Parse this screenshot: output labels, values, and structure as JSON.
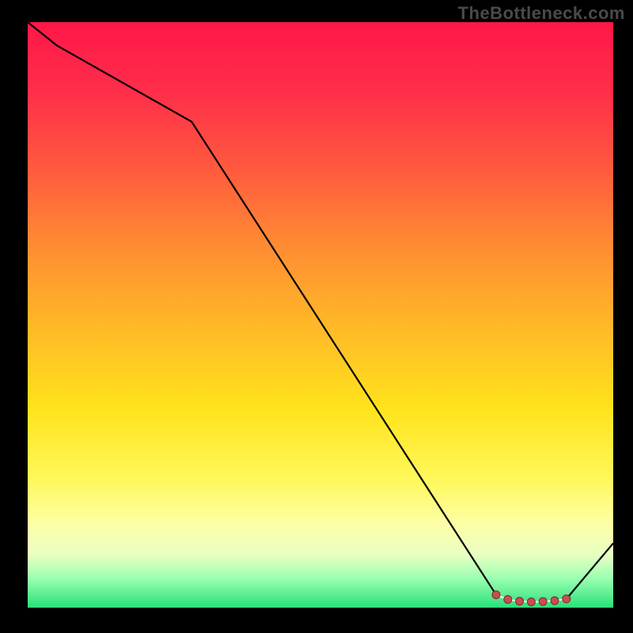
{
  "watermark": "TheBottleneck.com",
  "chart_data": {
    "type": "line",
    "title": "",
    "xlabel": "",
    "ylabel": "",
    "xlim": [
      0,
      100
    ],
    "ylim": [
      0,
      100
    ],
    "grid": false,
    "legend": false,
    "background_gradient": {
      "top": "#ff1748",
      "bottom": "#29e07a",
      "stops": [
        "red",
        "orange",
        "yellow",
        "pale-yellow",
        "green"
      ]
    },
    "x": [
      0,
      5,
      28,
      80,
      82,
      84,
      86,
      88,
      90,
      92,
      100
    ],
    "values": [
      100,
      96,
      83,
      2.2,
      1.4,
      1.1,
      1.0,
      1.05,
      1.2,
      1.5,
      11
    ],
    "markers": {
      "x": [
        80,
        82,
        84,
        86,
        88,
        90,
        92
      ],
      "y": [
        2.2,
        1.4,
        1.1,
        1.0,
        1.05,
        1.2,
        1.5
      ]
    },
    "note": "y=0 at bottom (green). Line descends from top-left, flattens near bottom-right with red markers, then rises slightly."
  }
}
